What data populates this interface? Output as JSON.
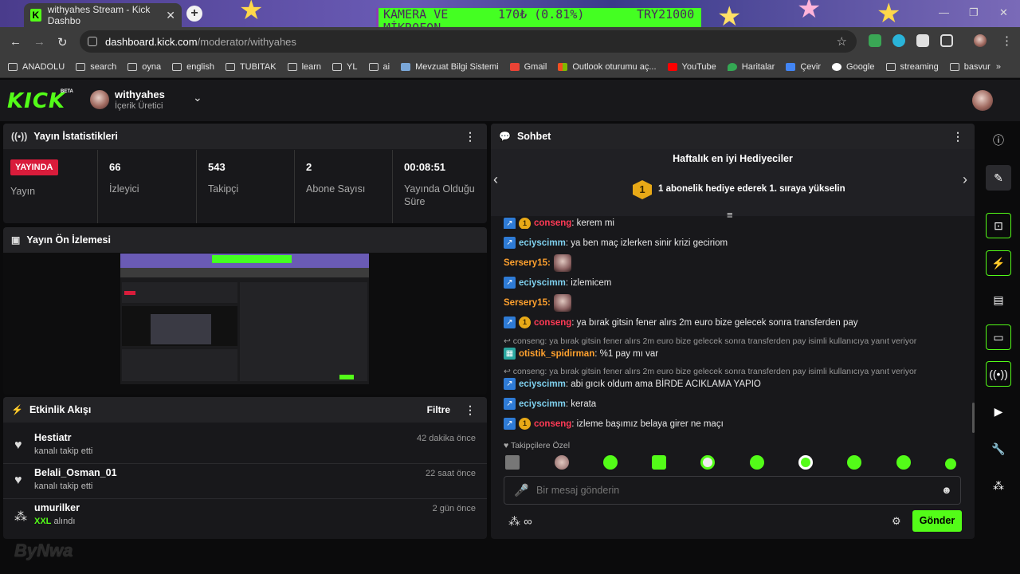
{
  "browser": {
    "tab_title": "withyahes Stream - Kick Dashbo",
    "url_host": "dashboard.kick.com",
    "url_path": "/moderator/withyahes",
    "overlay": {
      "line1": "KAMERA VE",
      "price": "170₺ (0.81%)",
      "amount": "TRY21000",
      "line2": "MİKROFON"
    },
    "bookmarks": [
      "ANADOLU",
      "search",
      "oyna",
      "english",
      "TUBITAK",
      "learn",
      "YL",
      "ai",
      "Mevzuat Bilgi Sistemi",
      "Gmail",
      "Outlook oturumu aç...",
      "YouTube",
      "Haritalar",
      "Çevir",
      "Google",
      "streaming",
      "basvur"
    ]
  },
  "header": {
    "logo": "KICK",
    "beta": "BETA",
    "username": "withyahes",
    "role": "İçerik Üretici"
  },
  "stats": {
    "title": "Yayın İstatistikleri",
    "live_badge": "YAYINDA",
    "live_label": "Yayın",
    "items": [
      {
        "value": "66",
        "label": "İzleyici"
      },
      {
        "value": "543",
        "label": "Takipçi"
      },
      {
        "value": "2",
        "label": "Abone Sayısı"
      },
      {
        "value": "00:08:51",
        "label": "Yayında Olduğu Süre"
      }
    ]
  },
  "preview": {
    "title": "Yayın Ön İzlemesi"
  },
  "activity": {
    "title": "Etkinlik Akışı",
    "filter": "Filtre",
    "items": [
      {
        "name": "Hestiatr",
        "sub": "kanalı takip etti",
        "time": "42 dakika önce"
      },
      {
        "name": "Belali_Osman_01",
        "sub": "kanalı takip etti",
        "time": "22 saat önce"
      },
      {
        "name": "umurilker",
        "sub_highlight": "XXL",
        "sub": "alındı",
        "time": "2 gün önce"
      }
    ]
  },
  "chat": {
    "title": "Sohbet",
    "gifters_title": "Haftalık en iyi Hediyeciler",
    "gifters_rank": "1",
    "gifters_text": "1 abonelik hediye ederek 1. sıraya yükselin",
    "messages": [
      {
        "user": "conseng",
        "text": ": kerem mi"
      },
      {
        "user": "eciyscimm",
        "text": ": ya ben maç izlerken sinir krizi geciriom"
      },
      {
        "user": "Sersery15:",
        "text": ""
      },
      {
        "user": "eciyscimm",
        "text": ": izlemicem"
      },
      {
        "user": "Sersery15:",
        "text": ""
      },
      {
        "user": "conseng",
        "text": ": ya bırak gitsin fener alırs 2m euro bize gelecek sonra transferden pay"
      },
      {
        "reply": "conseng: ya bırak gitsin fener alırs 2m euro bize gelecek sonra transferden pay isimli kullanıcıya yanıt veriyor"
      },
      {
        "user": "otistik_spidirman",
        "text": ": %1 pay mı var"
      },
      {
        "reply": "conseng: ya bırak gitsin fener alırs 2m euro bize gelecek sonra transferden pay isimli kullanıcıya yanıt veriyor"
      },
      {
        "user": "eciyscimm",
        "text": ": abi gıcık oldum ama BİRDE ACIKLAMA YAPIO"
      },
      {
        "user": "eciyscimm",
        "text": ": kerata"
      },
      {
        "user": "conseng",
        "text": ": izleme başımız belaya girer ne maçı"
      }
    ],
    "followers_only": "Takipçilere Özel",
    "input_placeholder": "Bir mesaj gönderin",
    "send": "Gönder",
    "points": "∞"
  },
  "watermark": "ByNwa",
  "colors": {
    "accent": "#53fc18",
    "live": "#d91c3b",
    "panel": "#18181b"
  }
}
